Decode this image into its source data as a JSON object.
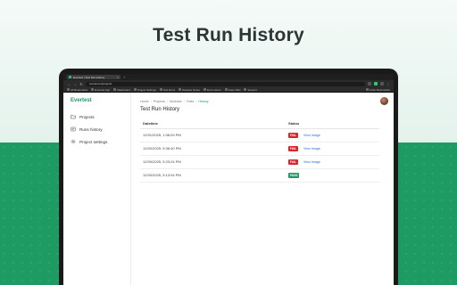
{
  "headline": "Test Run History",
  "browser": {
    "tab_title": "Evertest | Test Run History",
    "url": "evertest.io/projects",
    "bookmarks": [
      "All Bookmarks",
      "Evertest App",
      "Dashboard",
      "Project Settings",
      "Test Runs",
      "Release Notes",
      "Docs Home",
      "Team Wiki",
      "Support",
      "Other Bookmarks"
    ]
  },
  "sidebar": {
    "brand": "Evertest",
    "items": [
      {
        "label": "Projects",
        "icon": "folder-icon"
      },
      {
        "label": "Runs history",
        "icon": "history-icon"
      },
      {
        "label": "Project settings",
        "icon": "gear-icon"
      }
    ]
  },
  "breadcrumb": [
    "Home",
    "Projects",
    "Modules",
    "Tests",
    "History"
  ],
  "page_title": "Test Run History",
  "table": {
    "headers": [
      "Datetime",
      "Status"
    ],
    "view_label": "View Image",
    "rows": [
      {
        "datetime": "12/31/2025, 1:08:09 PM",
        "status": "FAIL",
        "has_view": true
      },
      {
        "datetime": "12/30/2025, 5:36:40 PM",
        "status": "FAIL",
        "has_view": true
      },
      {
        "datetime": "12/30/2025, 5:23:24 PM",
        "status": "FAIL",
        "has_view": true
      },
      {
        "datetime": "12/30/2025, 5:13:04 PM",
        "status": "PASS",
        "has_view": false
      }
    ]
  },
  "colors": {
    "accent": "#1e9b62",
    "fail": "#d9262c",
    "link": "#1f6fd1"
  }
}
